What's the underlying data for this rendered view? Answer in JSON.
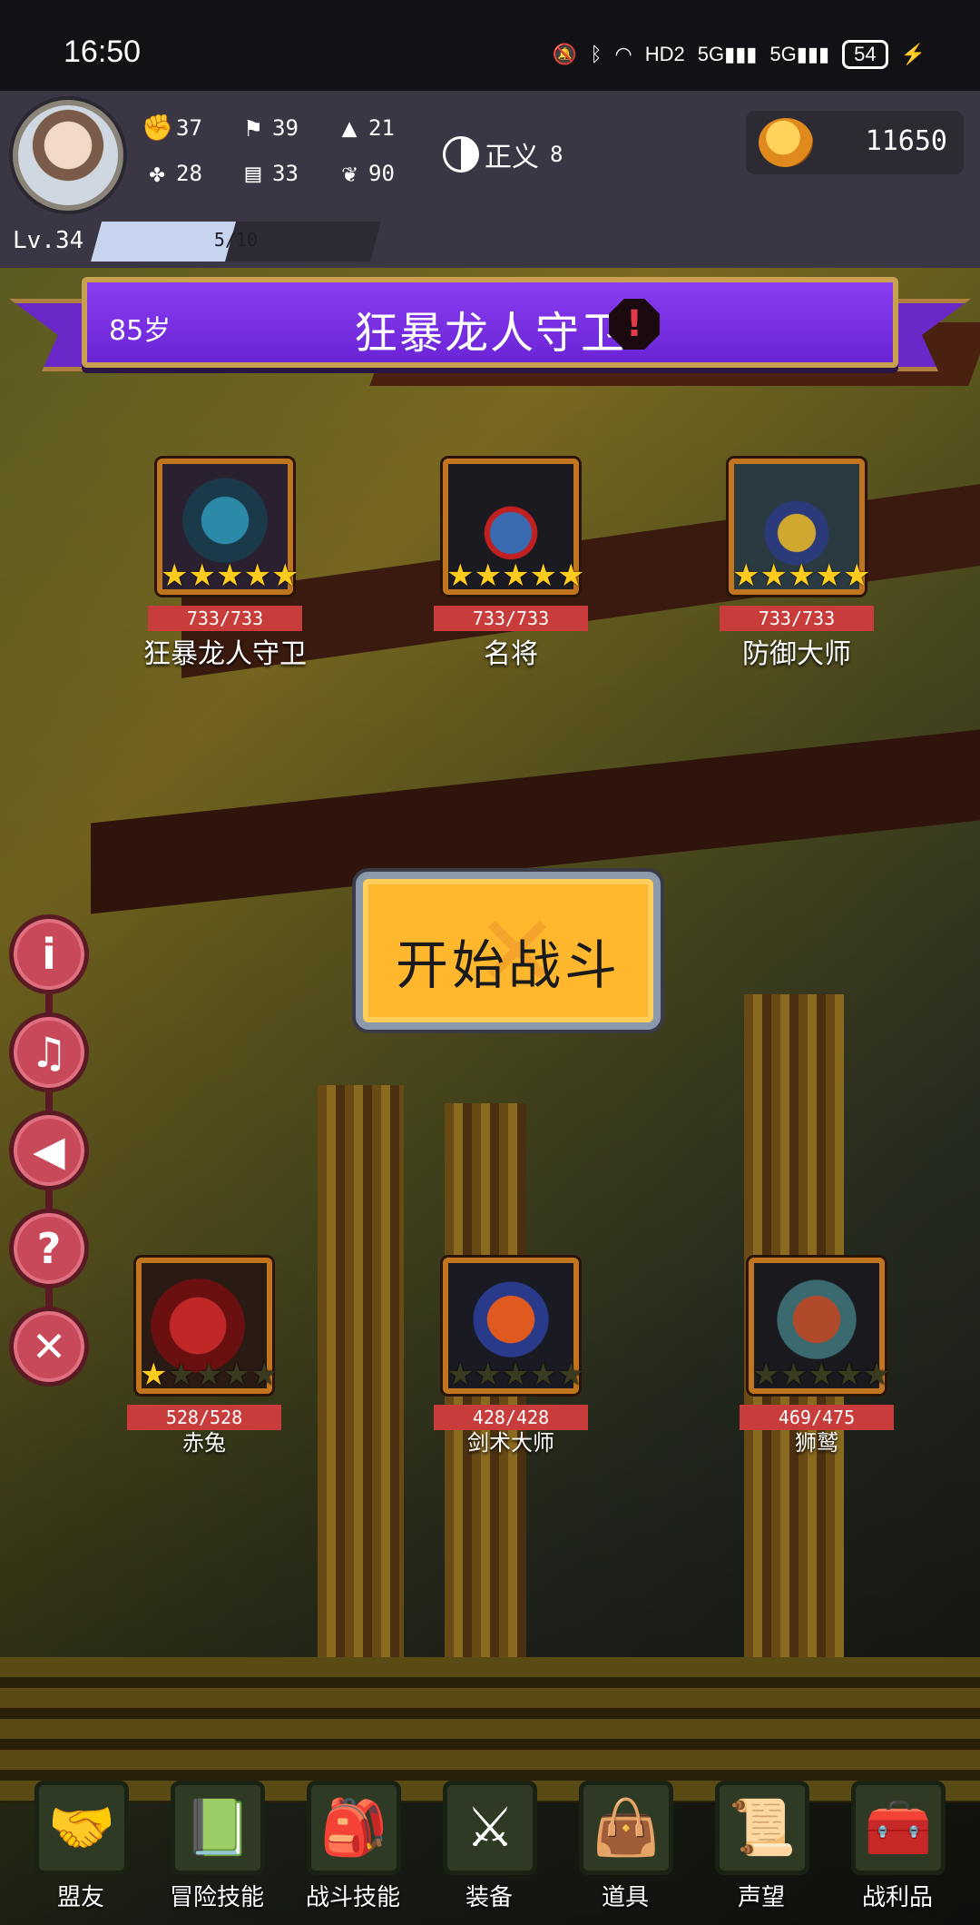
{
  "status": {
    "time": "16:50",
    "hd": "HD2",
    "net1": "5G",
    "net2": "5G",
    "battery": "54"
  },
  "player": {
    "stats": [
      {
        "icon": "fist-icon",
        "value": "37"
      },
      {
        "icon": "clover-icon",
        "value": "28"
      },
      {
        "icon": "boot-icon",
        "value": "39"
      },
      {
        "icon": "scroll-icon",
        "value": "33"
      },
      {
        "icon": "wizard-hat-icon",
        "value": "21"
      },
      {
        "icon": "wings-icon",
        "value": "90"
      }
    ],
    "justice_label": "正义",
    "justice_value": "8",
    "gold": "11650",
    "level": "Lv.34",
    "xp_text": "5/10",
    "xp_fraction": 0.5
  },
  "banner": {
    "age": "85岁",
    "title": "狂暴龙人守卫"
  },
  "enemies": [
    {
      "name": "狂暴龙人守卫",
      "hp": "733/733",
      "stars": 5
    },
    {
      "name": "名将",
      "hp": "733/733",
      "stars": 5
    },
    {
      "name": "防御大师",
      "hp": "733/733",
      "stars": 5
    }
  ],
  "allies": [
    {
      "name": "赤兔",
      "hp": "528/528",
      "stars": 1
    },
    {
      "name": "剑术大师",
      "hp": "428/428",
      "stars": 0
    },
    {
      "name": "狮鹫",
      "hp": "469/475",
      "stars": 0
    }
  ],
  "start_button": "开始战斗",
  "nav": [
    {
      "label": "盟友",
      "icon": "handshake-icon"
    },
    {
      "label": "冒险技能",
      "icon": "book-icon"
    },
    {
      "label": "战斗技能",
      "icon": "backpack-icon"
    },
    {
      "label": "装备",
      "icon": "crossed-swords-icon"
    },
    {
      "label": "道具",
      "icon": "satchel-icon"
    },
    {
      "label": "声望",
      "icon": "parchment-icon"
    },
    {
      "label": "战利品",
      "icon": "chest-icon"
    }
  ],
  "colors": {
    "banner": "#7a32e8",
    "hp": "#c83c3c",
    "start": "#ffb82e",
    "star": "#ffcc1e"
  }
}
